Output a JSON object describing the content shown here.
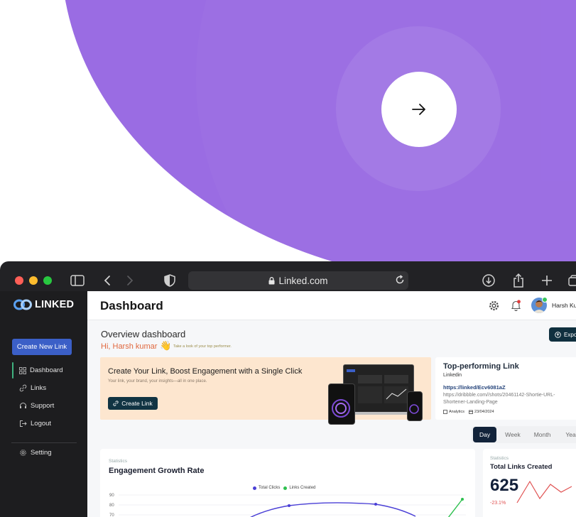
{
  "browser": {
    "url": "Linked.com"
  },
  "sidebar": {
    "logo": "LINKED",
    "create_button": "Create New Link",
    "items": [
      {
        "label": "Dashboard",
        "icon": "grid-icon",
        "active": true
      },
      {
        "label": "Links",
        "icon": "link-icon"
      },
      {
        "label": "Support",
        "icon": "headset-icon"
      },
      {
        "label": "Logout",
        "icon": "logout-icon"
      },
      {
        "label": "Setting",
        "icon": "gear-icon"
      }
    ]
  },
  "header": {
    "title": "Dashboard",
    "user_name": "Harsh Ku"
  },
  "overview": {
    "title": "Overview dashboard",
    "greeting": "Hi, Harsh kumar",
    "greeting_emoji": "👋",
    "subtitle": "Take a look of your top performer.",
    "export_label": "Expo"
  },
  "promo": {
    "heading": "Create Your Link, Boost Engagement with a Single Click",
    "subtext": "Your link, your brand, your insights—all in one place.",
    "button": "Create Link"
  },
  "top_link": {
    "title": "Top-performing Link",
    "source": "Linkedin",
    "short_url": "https://linked/Ecv6081aZ",
    "long_url": "https://dribbble.com//shots/20461142-Shortie-URL-Shortener-Landing-Page",
    "tag": "Analytics",
    "date": "23/04/2024"
  },
  "period_tabs": [
    "Day",
    "Week",
    "Month",
    "Yea"
  ],
  "engagement": {
    "label": "Statistics",
    "title": "Engagement Growth Rate",
    "legend": [
      "Total Clicks",
      "Links Created"
    ],
    "colors": {
      "clicks": "#4a3fd6",
      "links": "#2ec04f"
    }
  },
  "total_links": {
    "label": "Statistics",
    "title": "Total Links Created",
    "value": "625",
    "change": "-23.1%"
  },
  "chart_data": {
    "type": "line",
    "title": "Engagement Growth Rate",
    "y_ticks": [
      "90",
      "80",
      "70"
    ],
    "series": [
      {
        "name": "Total Clicks"
      },
      {
        "name": "Links Created"
      }
    ]
  }
}
